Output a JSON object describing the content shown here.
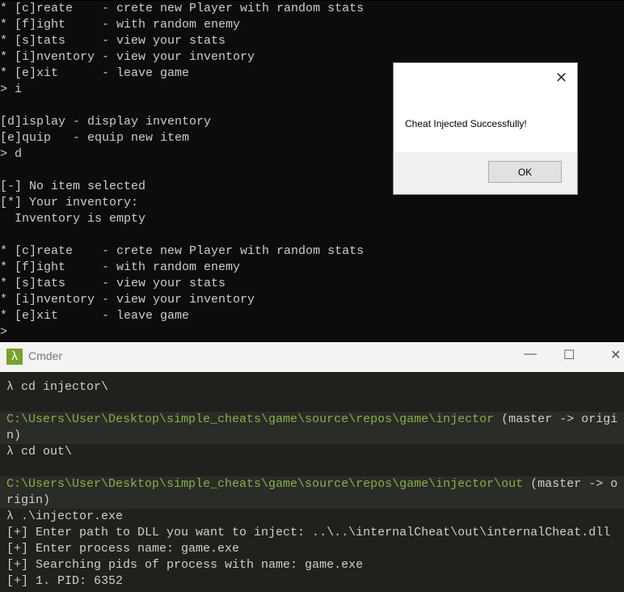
{
  "console": {
    "lines": [
      "* [c]reate    - crete new Player with random stats",
      "* [f]ight     - with random enemy",
      "* [s]tats     - view your stats",
      "* [i]nventory - view your inventory",
      "* [e]xit      - leave game",
      "> i",
      "",
      "[d]isplay - display inventory",
      "[e]quip   - equip new item",
      "> d",
      "",
      "[-] No item selected",
      "[*] Your inventory:",
      "  Inventory is empty",
      "",
      "* [c]reate    - crete new Player with random stats",
      "* [f]ight     - with random enemy",
      "* [s]tats     - view your stats",
      "* [i]nventory - view your inventory",
      "* [e]xit      - leave game",
      ">"
    ]
  },
  "dialog": {
    "message": "Cheat Injected Successfully!",
    "ok_label": "OK",
    "close": "✕"
  },
  "cmder": {
    "title": "Cmder",
    "logo": "λ",
    "minimize": "—",
    "maximize": "☐",
    "close": "✕",
    "lines": [
      {
        "text": "λ cd injector\\",
        "type": "cmd"
      },
      {
        "text": "",
        "type": "blank"
      },
      {
        "path": "C:\\Users\\User\\Desktop\\simple_cheats\\game\\source\\repos\\game\\injector",
        "branch": " (master -> origi",
        "type": "path"
      },
      {
        "text": "n)",
        "type": "band"
      },
      {
        "text": "λ cd out\\",
        "type": "cmd"
      },
      {
        "text": "",
        "type": "blank"
      },
      {
        "path": "C:\\Users\\User\\Desktop\\simple_cheats\\game\\source\\repos\\game\\injector\\out",
        "branch": " (master -> o",
        "type": "path"
      },
      {
        "text": "rigin)",
        "type": "band"
      },
      {
        "text": "λ .\\injector.exe",
        "type": "cmd"
      },
      {
        "text": "[+] Enter path to DLL you want to inject: ..\\..\\internalCheat\\out\\internalCheat.dll",
        "type": "out"
      },
      {
        "text": "[+] Enter process name: game.exe",
        "type": "out"
      },
      {
        "text": "[+] Searching pids of process with name: game.exe",
        "type": "out"
      },
      {
        "text": "[+] 1. PID: 6352",
        "type": "out"
      }
    ]
  }
}
